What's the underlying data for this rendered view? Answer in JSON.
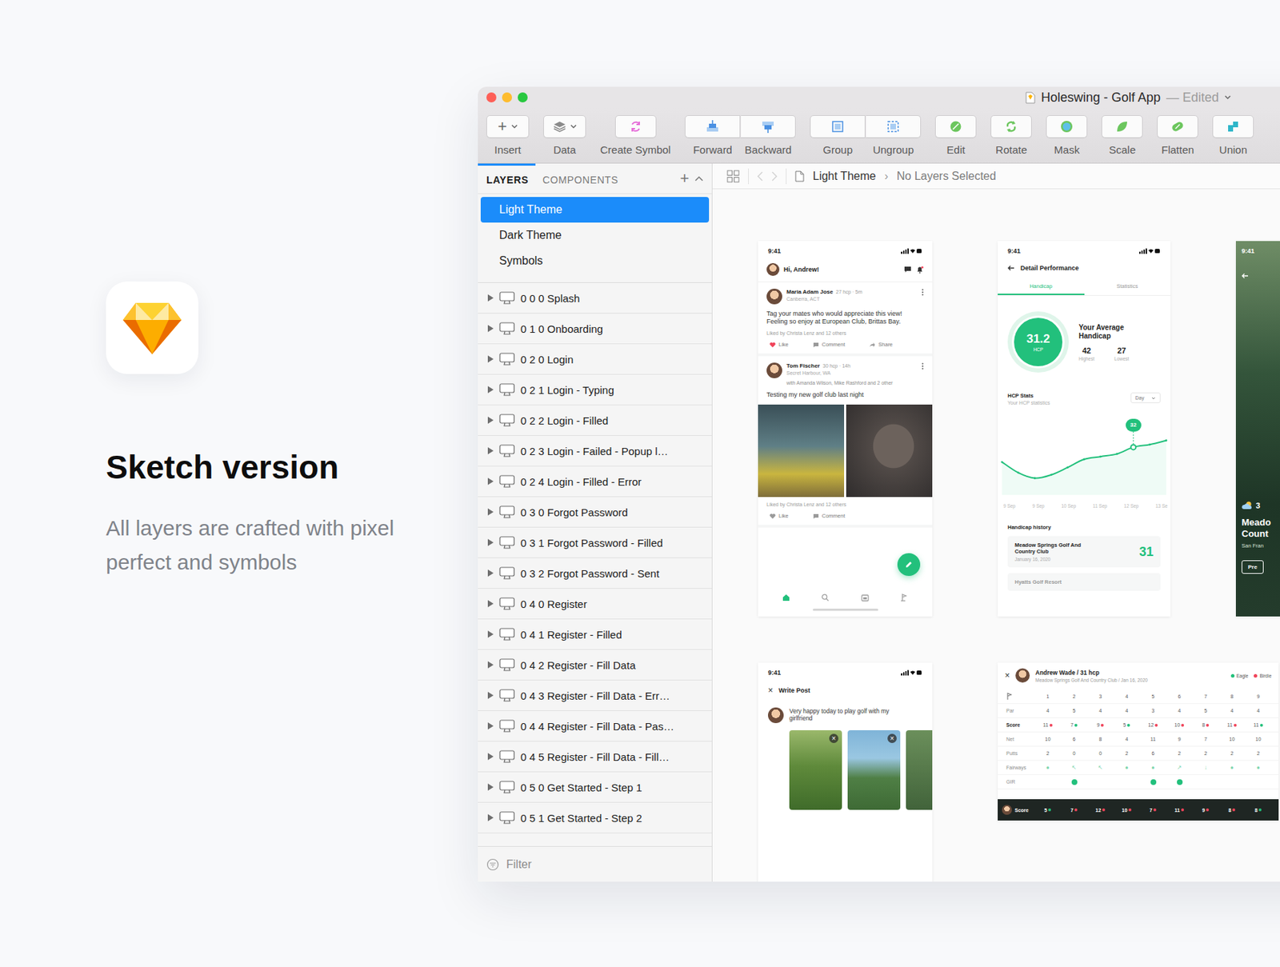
{
  "hero": {
    "title": "Sketch version",
    "subtitle": "All layers are crafted with pixel perfect and symbols"
  },
  "window": {
    "title": "Holeswing - Golf App",
    "status": "— Edited"
  },
  "toolbar": [
    {
      "label": "Insert",
      "kind": "dropdown",
      "glyph": "+"
    },
    {
      "label": "Data",
      "kind": "dropdown"
    },
    {
      "label": "Create Symbol",
      "kind": "button"
    },
    {
      "label": "Forward",
      "kind": "pair-start"
    },
    {
      "label": "Backward",
      "kind": "pair-end"
    },
    {
      "label": "Group",
      "kind": "pair-start"
    },
    {
      "label": "Ungroup",
      "kind": "pair-end"
    },
    {
      "label": "Edit",
      "kind": "button"
    },
    {
      "label": "Rotate",
      "kind": "button"
    },
    {
      "label": "Mask",
      "kind": "button"
    },
    {
      "label": "Scale",
      "kind": "button"
    },
    {
      "label": "Flatten",
      "kind": "button"
    },
    {
      "label": "Union",
      "kind": "button"
    }
  ],
  "sidebar": {
    "tabs": [
      {
        "label": "LAYERS",
        "selected": true
      },
      {
        "label": "COMPONENTS",
        "selected": false
      }
    ],
    "add": "+",
    "pages": [
      {
        "label": "Light Theme",
        "selected": true
      },
      {
        "label": "Dark Theme",
        "selected": false
      },
      {
        "label": "Symbols",
        "selected": false
      }
    ],
    "layers": [
      {
        "label": "0 0 0 Splash",
        "expanded": false
      },
      {
        "label": "0 1 0 Onboarding",
        "expanded": false
      },
      {
        "label": "0 2 0 Login",
        "expanded": false
      },
      {
        "label": "0 2 1 Login - Typing",
        "expanded": false
      },
      {
        "label": "0 2 2 Login - Filled",
        "expanded": false
      },
      {
        "label": "0 2 3 Login - Failed - Popup l…",
        "expanded": false
      },
      {
        "label": "0 2 4 Login - Filled - Error",
        "expanded": false
      },
      {
        "label": "0 3 0 Forgot Password",
        "expanded": false
      },
      {
        "label": "0 3 1 Forgot Password - Filled",
        "expanded": false
      },
      {
        "label": "0 3 2 Forgot Password - Sent",
        "expanded": false
      },
      {
        "label": "0 4 0 Register",
        "expanded": false
      },
      {
        "label": "0 4 1 Register - Filled",
        "expanded": false
      },
      {
        "label": "0 4 2 Register - Fill Data",
        "expanded": false
      },
      {
        "label": "0 4 3 Register - Fill Data - Err…",
        "expanded": false
      },
      {
        "label": "0 4 4 Register - Fill Data - Pas…",
        "expanded": false
      },
      {
        "label": "0 4 5 Register - Fill Data - Fill…",
        "expanded": false
      },
      {
        "label": "0 5 0 Get Started - Step 1",
        "expanded": false
      },
      {
        "label": "0 5 1 Get Started - Step 2",
        "expanded": false
      }
    ],
    "filter": {
      "placeholder": "Filter"
    }
  },
  "breadcrumb": {
    "page": "Light Theme",
    "separator": "›",
    "selection": "No Layers Selected"
  },
  "artboards": {
    "feed": {
      "time": "9:41",
      "greeting": "Hi, Andrew!",
      "posts": [
        {
          "kind": "text",
          "name": "Maria Adam Jose",
          "meta": "27 hcp · 5m",
          "location": "Canberra, ACT",
          "text": "Tag your mates who would appreciate this view! Feeling so enjoy at European Club, Brittas Bay.",
          "liked": "Liked by Christa Lenz and 12 others",
          "hearted": true,
          "actions": [
            "Like",
            "Comment",
            "Share"
          ]
        },
        {
          "kind": "photos",
          "name": "Tom Fischer",
          "meta": "30 hcp · 14h",
          "location": "Secret Harbour, WA",
          "tagged": "with Amanda Wilson, Mike Rashford and 2 other",
          "text": "Testing my new golf club last night",
          "liked": "Liked by Christa Lenz and 12 others",
          "hearted": false,
          "actions": [
            "Like",
            "Comment"
          ]
        }
      ],
      "nav": [
        {
          "selected": true
        },
        {
          "selected": false
        },
        {
          "selected": false
        },
        {
          "selected": false
        }
      ]
    },
    "performance": {
      "time": "9:41",
      "title": "Detail Performance",
      "tabs": [
        {
          "label": "Handicap",
          "selected": true
        },
        {
          "label": "Statistics",
          "selected": false
        }
      ],
      "handicap": "31.2",
      "unit": "HCP",
      "average_title": "Your Average Handicap",
      "stats": [
        {
          "value": "42",
          "label": "Highest"
        },
        {
          "value": "27",
          "label": "Lowest"
        }
      ],
      "chart": {
        "title": "HCP Stats",
        "subtitle": "Your HCP statistics",
        "period": "Day",
        "badge": "32",
        "points": [
          {
            "value": 29.8,
            "selected": false
          },
          {
            "value": 28.2,
            "selected": false
          },
          {
            "value": 27.4,
            "selected": false
          },
          {
            "value": 27.9,
            "selected": false
          },
          {
            "value": 29.0,
            "selected": false
          },
          {
            "value": 30.2,
            "selected": false
          },
          {
            "value": 30.6,
            "selected": false
          },
          {
            "value": 31.0,
            "selected": false
          },
          {
            "value": 32,
            "selected": true
          },
          {
            "value": 32.4,
            "selected": false
          },
          {
            "value": 33,
            "selected": false
          }
        ],
        "ticks": [
          "9 Sep",
          "9 Sep",
          "10 Sep",
          "11 Sep",
          "12 Sep",
          "13 Se"
        ]
      },
      "history_title": "Handicap history",
      "history": [
        {
          "club": "Meadow Springs Golf And Country Club",
          "date": "January 16, 2020",
          "score": "31"
        },
        {
          "club": "Hyatts Golf Resort"
        }
      ]
    },
    "course": {
      "time": "9:41",
      "weather": "3",
      "title": [
        "Meado",
        "Count"
      ],
      "location": "San Fran",
      "button": "Pre"
    },
    "write_post": {
      "time": "9:41",
      "close": "×",
      "title": "Write Post",
      "text": "Very happy today to play golf with my girlfriend",
      "remove_glyph": "×",
      "photos": [
        {
          "removable": true
        },
        {
          "removable": true
        },
        {
          "removable": false
        }
      ]
    },
    "scorecard": {
      "close": "×",
      "player": "Andrew Wade / 31 hcp",
      "course": "Meadow Springs Golf And Country Club / Jan 16, 2020",
      "legend": [
        {
          "label": "Eagle",
          "color": "#21c07a"
        },
        {
          "label": "Birdie",
          "color": "#f0445a"
        }
      ],
      "holes": [
        "1",
        "2",
        "3",
        "4",
        "5",
        "6",
        "7",
        "8",
        "9"
      ],
      "rows": [
        {
          "label": "Par",
          "kind": "text",
          "cells": [
            "4",
            "5",
            "4",
            "4",
            "3",
            "4",
            "5",
            "4",
            "4"
          ]
        },
        {
          "label": "Score",
          "kind": "score",
          "cells": [
            {
              "value": "11",
              "color": "#f0445a"
            },
            {
              "value": "7",
              "color": "#21c07a"
            },
            {
              "value": "9",
              "color": "#f0445a"
            },
            {
              "value": "5",
              "color": "#21c07a"
            },
            {
              "value": "12",
              "color": "#f0445a"
            },
            {
              "value": "10",
              "color": "#f0445a"
            },
            {
              "value": "8",
              "color": "#f0445a"
            },
            {
              "value": "11",
              "color": "#f0445a"
            },
            {
              "value": "11",
              "color": "#21c07a"
            }
          ]
        },
        {
          "label": "Net",
          "kind": "text",
          "cells": [
            "10",
            "6",
            "8",
            "4",
            "11",
            "9",
            "7",
            "10",
            "10"
          ]
        },
        {
          "label": "Putts",
          "kind": "text",
          "cells": [
            "2",
            "0",
            "0",
            "2",
            "6",
            "2",
            "2",
            "2",
            "2"
          ]
        },
        {
          "label": "Fairways",
          "kind": "glyph",
          "cells": [
            "●",
            "↖",
            "↖",
            "●",
            "●",
            "↗",
            "↓",
            "●",
            "●"
          ]
        },
        {
          "label": "GIR",
          "kind": "dot",
          "cells": [
            false,
            true,
            false,
            false,
            true,
            true,
            false,
            false,
            false
          ]
        }
      ],
      "total": {
        "label": "Score",
        "cells": [
          {
            "value": "5",
            "color": "#21c07a"
          },
          {
            "value": "7",
            "color": "#f0445a"
          },
          {
            "value": "12",
            "color": "#f0445a"
          },
          {
            "value": "10",
            "color": "#f0445a"
          },
          {
            "value": "7",
            "color": "#f0445a"
          },
          {
            "value": "11",
            "color": "#f0445a"
          },
          {
            "value": "9",
            "color": "#f0445a"
          },
          {
            "value": "8",
            "color": "#f0445a"
          },
          {
            "value": "8",
            "color": "#21c07a"
          }
        ]
      }
    }
  }
}
